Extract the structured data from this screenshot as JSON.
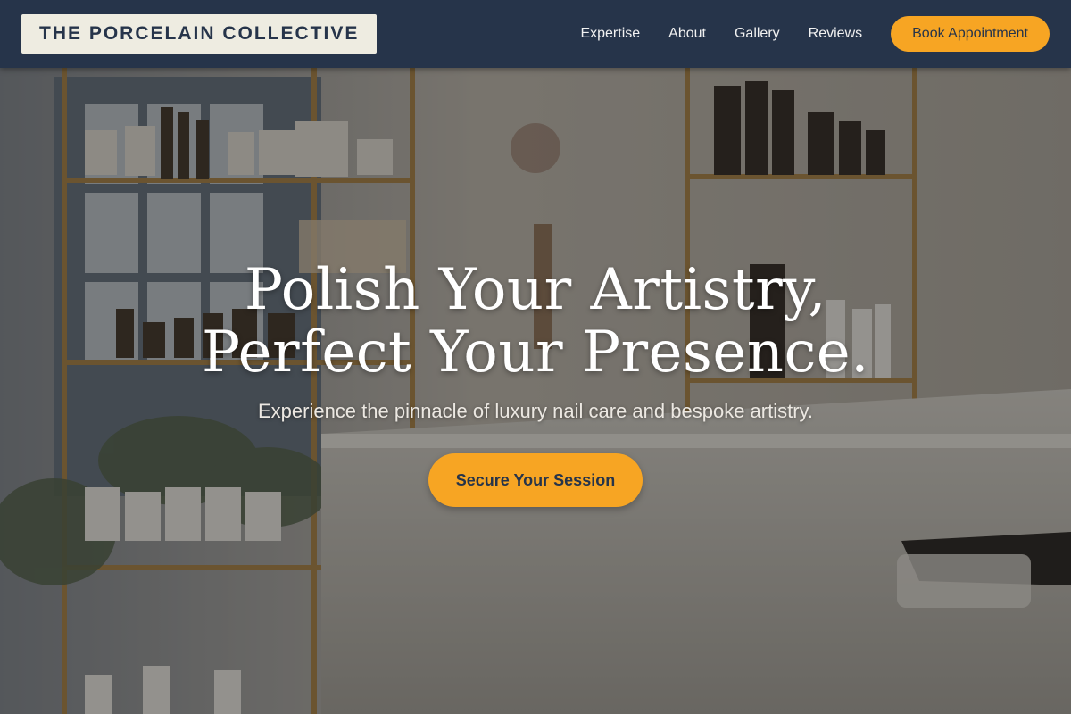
{
  "brand": {
    "name": "THE PORCELAIN COLLECTIVE"
  },
  "nav": {
    "links": [
      "Expertise",
      "About",
      "Gallery",
      "Reviews"
    ],
    "cta_label": "Book Appointment"
  },
  "hero": {
    "title_line1": "Polish Your Artistry,",
    "title_line2": "Perfect Your Presence.",
    "subtitle": "Experience the pinnacle of luxury nail care and bespoke artistry.",
    "cta_label": "Secure Your Session"
  },
  "colors": {
    "header_bg": "#26344a",
    "accent": "#f7a523",
    "logo_bg": "#eeece1"
  }
}
